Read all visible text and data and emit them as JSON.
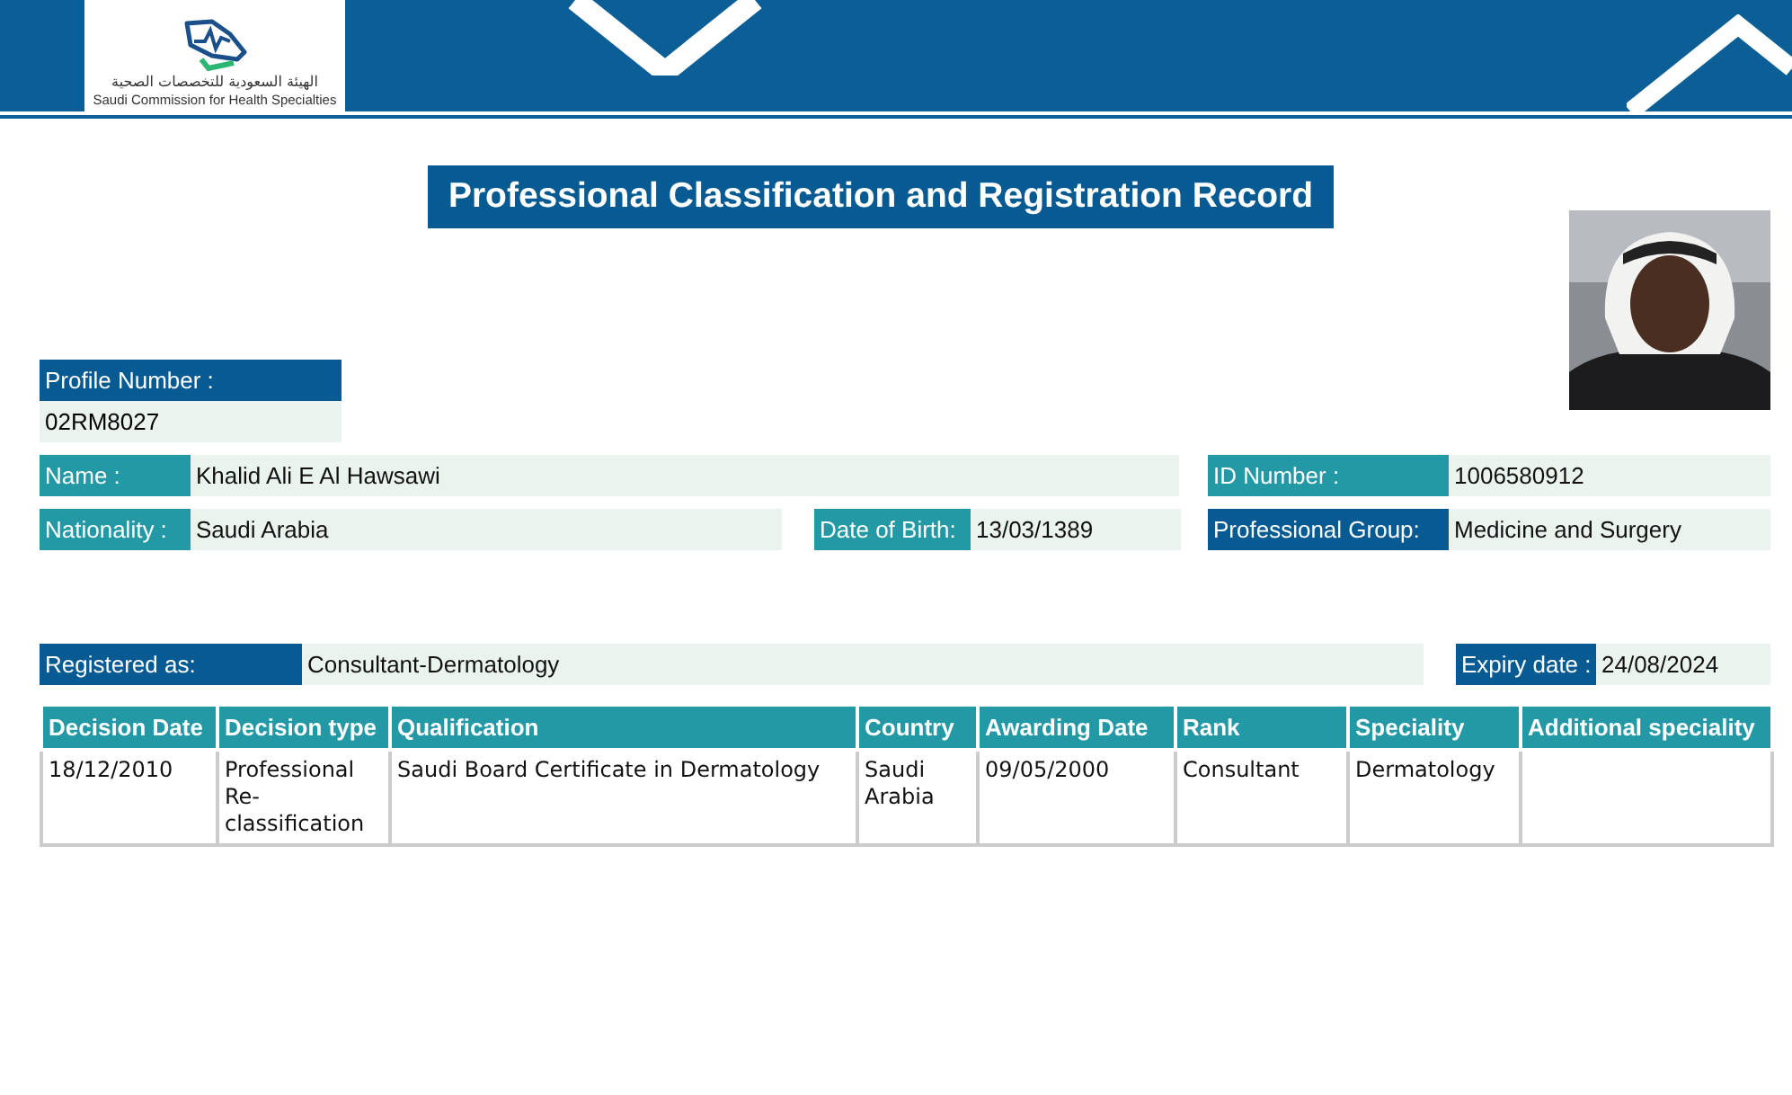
{
  "header": {
    "logo_arabic": "الهيئة السعودية للتخصصات الصحية",
    "logo_english": "Saudi Commission for Health Specialties"
  },
  "title": "Professional Classification and Registration Record",
  "profile": {
    "label": "Profile Number :",
    "value": "02RM8027"
  },
  "field_rows": [
    [
      {
        "label": "Name :",
        "value": "Khalid Ali E Al Hawsawi",
        "kind": "teal"
      },
      {
        "label": "ID Number :",
        "value": "1006580912",
        "kind": "teal"
      }
    ],
    [
      {
        "label": "Nationality :",
        "value": "Saudi Arabia",
        "kind": "teal"
      },
      {
        "label": "Date of Birth:",
        "value": "13/03/1389",
        "kind": "teal"
      },
      {
        "label": "Professional Group:",
        "value": "Medicine and Surgery",
        "kind": "navy"
      }
    ]
  ],
  "registration": [
    {
      "label": "Registered as:",
      "value": "Consultant-Dermatology",
      "kind": "navy"
    },
    {
      "label": "Expiry date :",
      "value": "24/08/2024",
      "kind": "navy"
    }
  ],
  "table": {
    "columns": [
      "Decision Date",
      "Decision type",
      "Qualification",
      "Country",
      "Awarding Date",
      "Rank",
      "Speciality",
      "Additional speciality"
    ],
    "rows": [
      [
        "18/12/2010",
        "Professional Re-classification",
        "Saudi Board Certificate in Dermatology",
        "Saudi Arabia",
        "09/05/2000",
        "Consultant",
        "Dermatology",
        ""
      ]
    ]
  }
}
